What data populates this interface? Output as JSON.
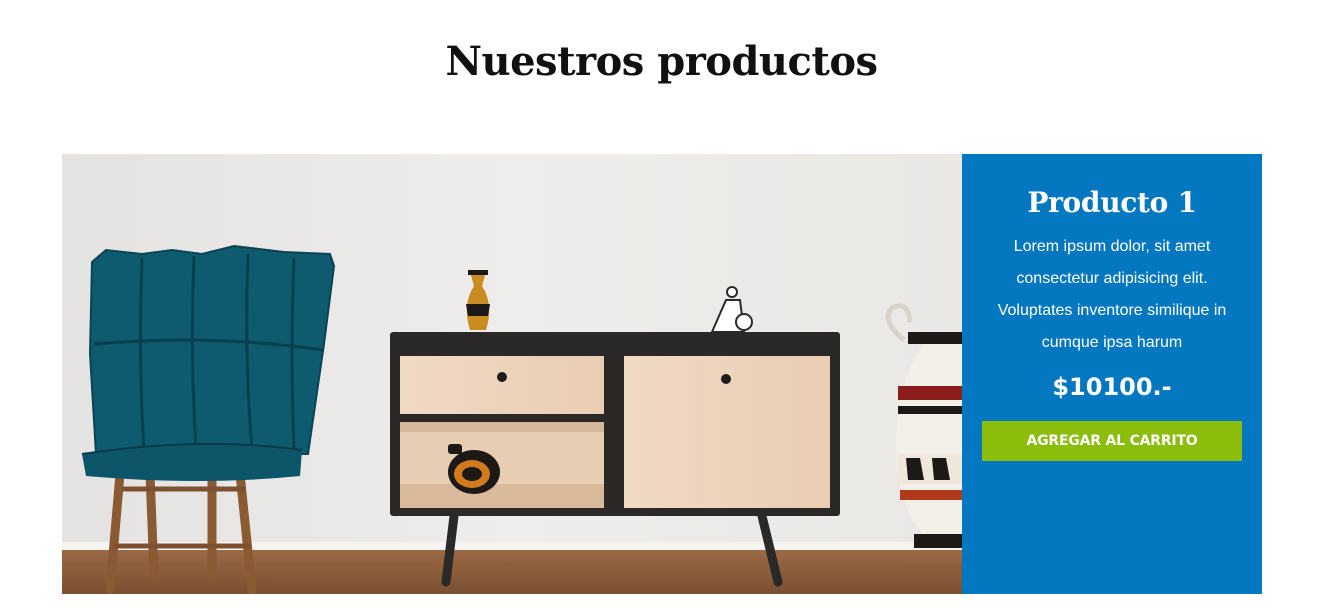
{
  "section": {
    "title": "Nuestros productos"
  },
  "product": {
    "name": "Producto 1",
    "description": "Lorem ipsum dolor, sit amet consectetur adipisicing elit. Voluptates inventore similique in cumque ipsa harum",
    "price": "$10100.-",
    "add_to_cart_label": "AGREGAR AL CARRITO",
    "image_subject": "living-room-furniture-photo"
  },
  "colors": {
    "info_panel": "#0378c0",
    "cart_button": "#8bbd0c",
    "title_text": "#111111"
  }
}
